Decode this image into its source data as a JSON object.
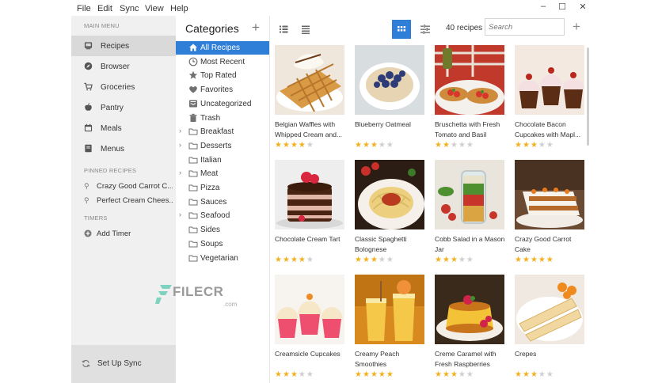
{
  "menu": [
    "File",
    "Edit",
    "Sync",
    "View",
    "Help"
  ],
  "sidebar": {
    "main_menu_label": "MAIN MENU",
    "items": [
      {
        "label": "Recipes",
        "icon": "recipes-icon",
        "active": true
      },
      {
        "label": "Browser",
        "icon": "compass-icon"
      },
      {
        "label": "Groceries",
        "icon": "cart-icon"
      },
      {
        "label": "Pantry",
        "icon": "apple-icon"
      },
      {
        "label": "Meals",
        "icon": "calendar-icon"
      },
      {
        "label": "Menus",
        "icon": "book-icon"
      }
    ],
    "pinned_label": "PINNED RECIPES",
    "pinned": [
      {
        "label": "Crazy Good Carrot C..."
      },
      {
        "label": "Perfect Cream Chees..."
      }
    ],
    "timers_label": "TIMERS",
    "add_timer": "Add Timer",
    "sync": "Set Up Sync"
  },
  "categories": {
    "title": "Categories",
    "items": [
      {
        "label": "All Recipes",
        "icon": "home-icon",
        "active": true
      },
      {
        "label": "Most Recent",
        "icon": "clock-icon"
      },
      {
        "label": "Top Rated",
        "icon": "star-icon"
      },
      {
        "label": "Favorites",
        "icon": "heart-icon"
      },
      {
        "label": "Uncategorized",
        "icon": "inbox-icon"
      },
      {
        "label": "Trash",
        "icon": "trash-icon"
      },
      {
        "label": "Breakfast",
        "icon": "folder-icon",
        "expandable": true
      },
      {
        "label": "Desserts",
        "icon": "folder-icon",
        "expandable": true
      },
      {
        "label": "Italian",
        "icon": "folder-icon"
      },
      {
        "label": "Meat",
        "icon": "folder-icon",
        "expandable": true
      },
      {
        "label": "Pizza",
        "icon": "folder-icon"
      },
      {
        "label": "Sauces",
        "icon": "folder-icon"
      },
      {
        "label": "Seafood",
        "icon": "folder-icon",
        "expandable": true
      },
      {
        "label": "Sides",
        "icon": "folder-icon"
      },
      {
        "label": "Soups",
        "icon": "folder-icon"
      },
      {
        "label": "Vegetarian",
        "icon": "folder-icon"
      }
    ]
  },
  "toolbar": {
    "count": "40 recipes",
    "search_placeholder": "Search",
    "views": [
      "list-detail-icon",
      "list-icon",
      "grid-icon",
      "filter-icon"
    ]
  },
  "recipes": [
    {
      "title": "Belgian Waffles with Whipped Cream and...",
      "rating": 4,
      "photo": "waffles"
    },
    {
      "title": "Blueberry Oatmeal",
      "rating": 3,
      "photo": "oatmeal"
    },
    {
      "title": "Bruschetta with Fresh Tomato and Basil",
      "rating": 2,
      "photo": "bruschetta"
    },
    {
      "title": "Chocolate Bacon Cupcakes with Mapl...",
      "rating": 3,
      "photo": "choc-cupcakes"
    },
    {
      "title": "Chocolate Cream Tart",
      "rating": 4,
      "photo": "tart"
    },
    {
      "title": "Classic Spaghetti Bolognese",
      "rating": 3,
      "photo": "spaghetti"
    },
    {
      "title": "Cobb Salad in a Mason Jar",
      "rating": 3,
      "photo": "salad-jar"
    },
    {
      "title": "Crazy Good Carrot Cake",
      "rating": 5,
      "photo": "carrot-cake"
    },
    {
      "title": "Creamsicle Cupcakes",
      "rating": 3,
      "photo": "cream-cupcakes"
    },
    {
      "title": "Creamy Peach Smoothies",
      "rating": 5,
      "photo": "smoothies"
    },
    {
      "title": "Creme Caramel with Fresh Raspberries",
      "rating": 3,
      "photo": "flan"
    },
    {
      "title": "Crepes",
      "rating": 3,
      "photo": "crepes"
    }
  ],
  "watermark": {
    "text": "FILECR",
    "sub": ".com"
  }
}
